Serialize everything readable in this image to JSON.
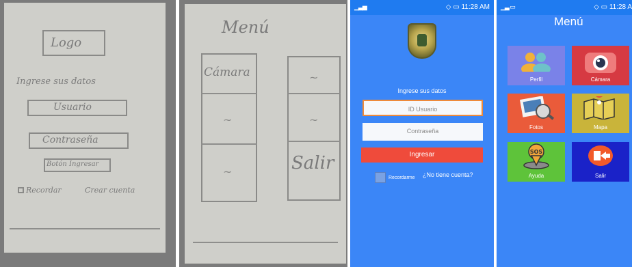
{
  "sketch_login": {
    "logo": "Logo",
    "prompt": "Ingrese sus datos",
    "user_field": "Usuario",
    "password_field": "Contraseña",
    "submit": "Botón Ingresar",
    "remember": "Recordar",
    "create_account": "Crear cuenta"
  },
  "sketch_menu": {
    "title": "Menú",
    "camera": "Cámara",
    "exit": "Salir",
    "squiggle": "~"
  },
  "login_screen": {
    "status_time": "11:28 AM",
    "prompt": "Ingrese sus datos",
    "user_placeholder": "ID Usuario",
    "password_placeholder": "Contraseña",
    "submit_label": "Ingresar",
    "remember_label": "Recordarme",
    "no_account_link": "¿No tiene cuenta?"
  },
  "menu_screen": {
    "status_time": "11:28 A",
    "title": "Menú",
    "tiles": [
      {
        "label": "Perfil",
        "icon": "users-icon",
        "color": "#7a82e8"
      },
      {
        "label": "Cámara",
        "icon": "camera-icon",
        "color": "#d63a42"
      },
      {
        "label": "Fotos",
        "icon": "photos-icon",
        "color": "#ea5b3a"
      },
      {
        "label": "Mapa",
        "icon": "map-icon",
        "color": "#c9b43a"
      },
      {
        "label": "Ayuda",
        "icon": "sos-icon",
        "color": "#5ec33a"
      },
      {
        "label": "Salir",
        "icon": "exit-icon",
        "color": "#1a22c8"
      }
    ]
  }
}
